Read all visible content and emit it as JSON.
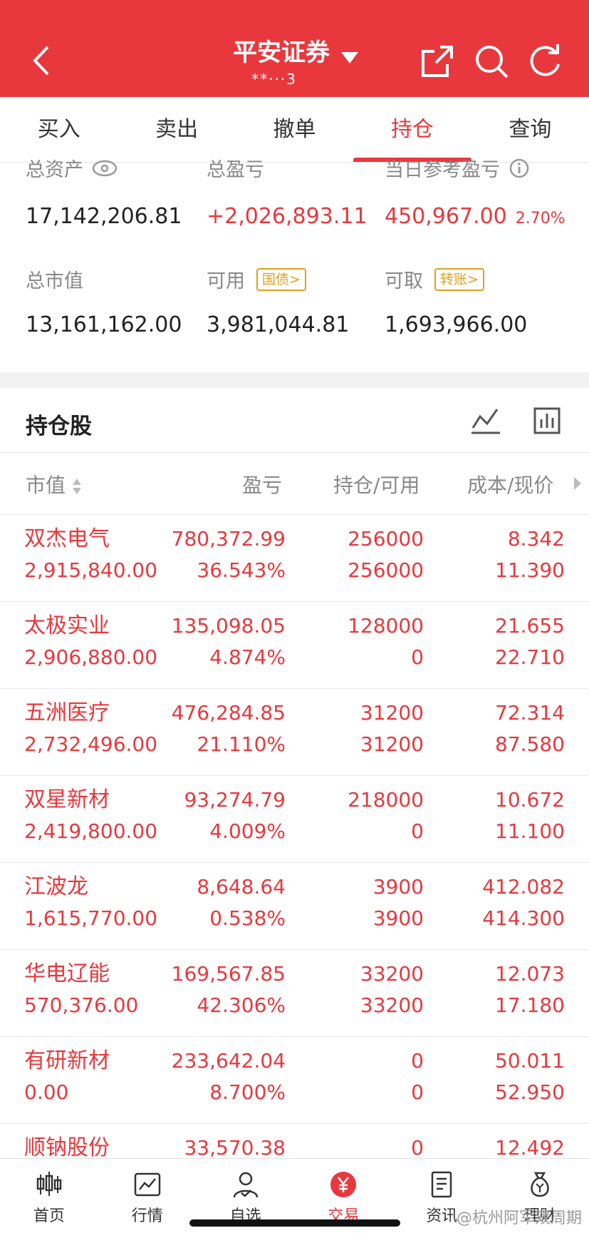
{
  "header": {
    "title": "平安证券",
    "account": "**···3"
  },
  "tabs": [
    "买入",
    "卖出",
    "撤单",
    "持仓",
    "查询"
  ],
  "summary": {
    "total_assets_label": "总资产",
    "total_assets": "17,142,206.81",
    "total_pl_label": "总盈亏",
    "total_pl": "+2,026,893.11",
    "today_pl_label": "当日参考盈亏",
    "today_pl": "450,967.00",
    "today_pct": "2.70%",
    "market_value_label": "总市值",
    "market_value": "13,161,162.00",
    "available_label": "可用",
    "available_badge": "国债>",
    "available": "3,981,044.81",
    "withdrawable_label": "可取",
    "withdrawable_badge": "转账>",
    "withdrawable": "1,693,966.00"
  },
  "holdings": {
    "title": "持仓股",
    "columns": {
      "market_value": "市值",
      "pl": "盈亏",
      "position": "持仓/可用",
      "cost_price": "成本/现价"
    },
    "rows": [
      {
        "name": "双杰电气",
        "market_value": "2,915,840.00",
        "pl": "780,372.99",
        "pl_pct": "36.543%",
        "position": "256000",
        "available": "256000",
        "cost": "8.342",
        "price": "11.390"
      },
      {
        "name": "太极实业",
        "market_value": "2,906,880.00",
        "pl": "135,098.05",
        "pl_pct": "4.874%",
        "position": "128000",
        "available": "0",
        "cost": "21.655",
        "price": "22.710"
      },
      {
        "name": "五洲医疗",
        "market_value": "2,732,496.00",
        "pl": "476,284.85",
        "pl_pct": "21.110%",
        "position": "31200",
        "available": "31200",
        "cost": "72.314",
        "price": "87.580"
      },
      {
        "name": "双星新材",
        "market_value": "2,419,800.00",
        "pl": "93,274.79",
        "pl_pct": "4.009%",
        "position": "218000",
        "available": "0",
        "cost": "10.672",
        "price": "11.100"
      },
      {
        "name": "江波龙",
        "market_value": "1,615,770.00",
        "pl": "8,648.64",
        "pl_pct": "0.538%",
        "position": "3900",
        "available": "3900",
        "cost": "412.082",
        "price": "414.300"
      },
      {
        "name": "华电辽能",
        "market_value": "570,376.00",
        "pl": "169,567.85",
        "pl_pct": "42.306%",
        "position": "33200",
        "available": "33200",
        "cost": "12.073",
        "price": "17.180"
      },
      {
        "name": "有研新材",
        "market_value": "0.00",
        "pl": "233,642.04",
        "pl_pct": "8.700%",
        "position": "0",
        "available": "0",
        "cost": "50.011",
        "price": "52.950"
      },
      {
        "name": "顺钠股份",
        "market_value": "",
        "pl": "33,570.38",
        "pl_pct": "",
        "position": "0",
        "available": "",
        "cost": "12.492",
        "price": ""
      }
    ]
  },
  "bottom_nav": [
    "首页",
    "行情",
    "自选",
    "交易",
    "资讯",
    "理财"
  ],
  "watermark": "@杭州阿军双周期",
  "colors": {
    "brand_red": "#e8383d",
    "badge_gold": "#e0a020"
  }
}
